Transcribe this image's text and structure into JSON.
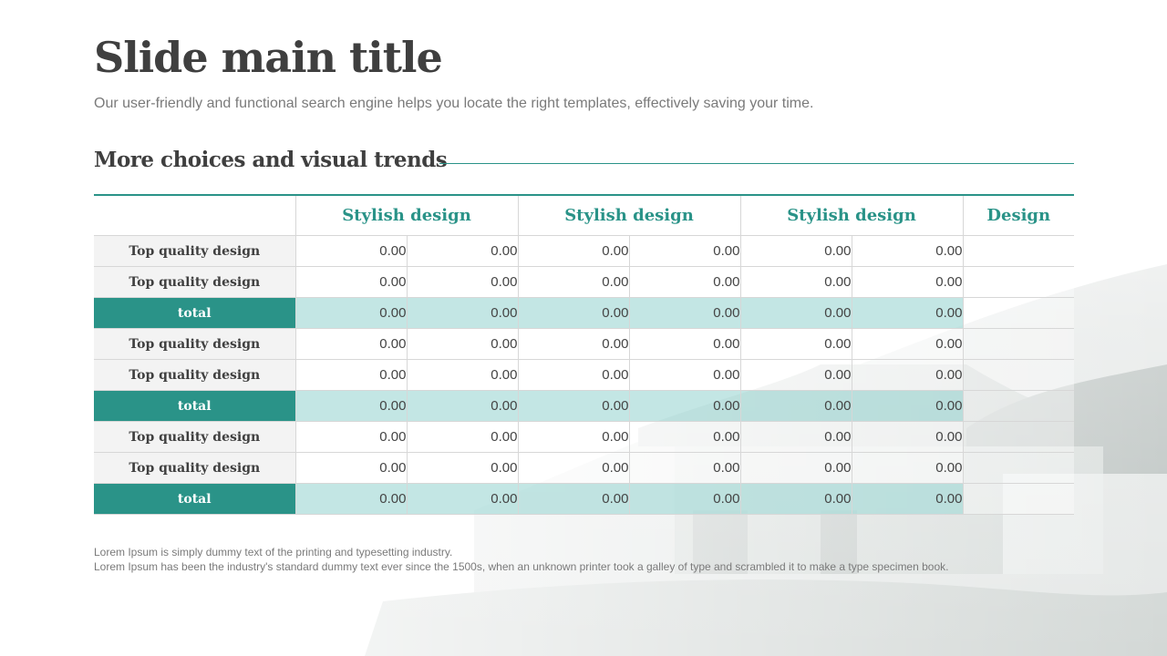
{
  "slide": {
    "title": "Slide main title",
    "subtitle": "Our user-friendly and functional search engine helps you locate the right templates, effectively saving your time.",
    "section_heading": "More choices and visual trends"
  },
  "table": {
    "headers": [
      "Stylish design",
      "Stylish design",
      "Stylish design",
      "Design"
    ],
    "rows": [
      {
        "label": "Top quality design",
        "values": [
          "0.00",
          "0.00",
          "0.00",
          "0.00",
          "0.00",
          "0.00"
        ]
      },
      {
        "label": "Top quality design",
        "values": [
          "0.00",
          "0.00",
          "0.00",
          "0.00",
          "0.00",
          "0.00"
        ]
      },
      {
        "label": "total",
        "values": [
          "0.00",
          "0.00",
          "0.00",
          "0.00",
          "0.00",
          "0.00"
        ]
      },
      {
        "label": "Top quality design",
        "values": [
          "0.00",
          "0.00",
          "0.00",
          "0.00",
          "0.00",
          "0.00"
        ]
      },
      {
        "label": "Top quality design",
        "values": [
          "0.00",
          "0.00",
          "0.00",
          "0.00",
          "0.00",
          "0.00"
        ]
      },
      {
        "label": "total",
        "values": [
          "0.00",
          "0.00",
          "0.00",
          "0.00",
          "0.00",
          "0.00"
        ]
      },
      {
        "label": "Top quality design",
        "values": [
          "0.00",
          "0.00",
          "0.00",
          "0.00",
          "0.00",
          "0.00"
        ]
      },
      {
        "label": "Top quality design",
        "values": [
          "0.00",
          "0.00",
          "0.00",
          "0.00",
          "0.00",
          "0.00"
        ]
      },
      {
        "label": "total",
        "values": [
          "0.00",
          "0.00",
          "0.00",
          "0.00",
          "0.00",
          "0.00"
        ]
      }
    ]
  },
  "footnote": {
    "line1": "Lorem Ipsum is simply dummy text of the printing and typesetting industry.",
    "line2": "Lorem Ipsum has been the industry's standard dummy text ever since the 1500s, when an unknown printer took a galley of type and scrambled it to make a type specimen book."
  },
  "colors": {
    "accent": "#2a9388",
    "total_fill": "#aadcd8",
    "label_fill": "#f2f2f2"
  }
}
